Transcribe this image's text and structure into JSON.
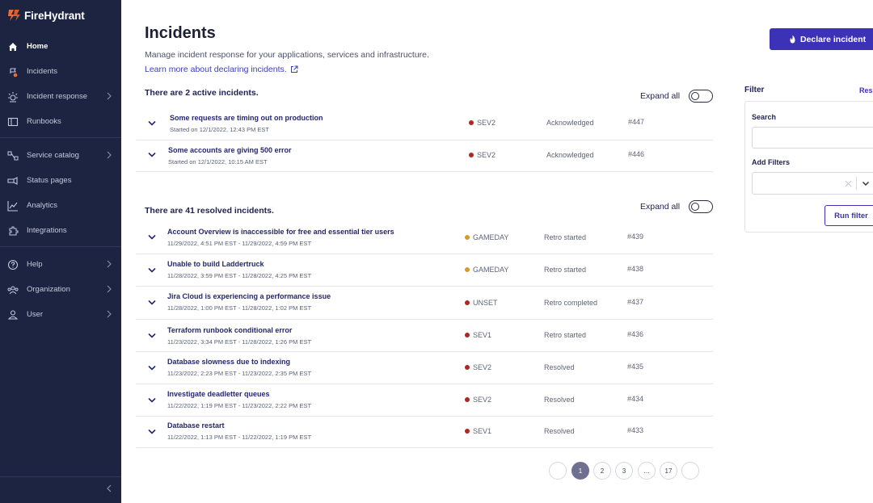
{
  "app": {
    "brand": "FireHydrant"
  },
  "colors": {
    "sidebar": "#1c2442",
    "accent": "#3b32b8",
    "link": "#3b3fb5",
    "sev_red": "#b3261e",
    "sev_gameday": "#d69a2d"
  },
  "sidebar": {
    "items": [
      {
        "label": "Home",
        "icon": "home-icon"
      },
      {
        "label": "Incidents",
        "icon": "incidents-icon"
      },
      {
        "label": "Incident response",
        "icon": "incident-response-icon"
      },
      {
        "label": "Runbooks",
        "icon": "runbooks-icon"
      },
      {
        "label": "Service catalog",
        "icon": "service-catalog-icon"
      },
      {
        "label": "Status pages",
        "icon": "status-pages-icon"
      },
      {
        "label": "Analytics",
        "icon": "analytics-icon"
      },
      {
        "label": "Integrations",
        "icon": "integrations-icon"
      },
      {
        "label": "Help",
        "icon": "help-icon"
      },
      {
        "label": "Organization",
        "icon": "organization-icon"
      },
      {
        "label": "User",
        "icon": "user-icon"
      }
    ]
  },
  "header": {
    "title": "Incidents",
    "subtitle": "Manage incident response for your applications, services and infrastructure.",
    "learn_more": "Learn more about declaring incidents.",
    "declare_button": "Declare incident"
  },
  "active": {
    "heading": "There are 2 active incidents.",
    "expand_all": "Expand all",
    "rows": [
      {
        "title": "Some requests are timing out on production",
        "meta": "Started on 12/1/2022, 12:43 PM EST",
        "sev": "SEV2",
        "sev_color": "#b3261e",
        "status": "Acknowledged",
        "number": "#447"
      },
      {
        "title": "Some accounts are giving 500 error",
        "meta": "Started on 12/1/2022, 10:15 AM EST",
        "sev": "SEV2",
        "sev_color": "#b3261e",
        "status": "Acknowledged",
        "number": "#446"
      }
    ]
  },
  "resolved": {
    "heading": "There are 41 resolved incidents.",
    "expand_all": "Expand all",
    "rows": [
      {
        "title": "Account Overview is inaccessible for free and essential tier users",
        "meta": "11/29/2022, 4:51 PM EST - 11/29/2022, 4:59 PM EST",
        "sev": "GAMEDAY",
        "sev_color": "#d69a2d",
        "status": "Retro started",
        "number": "#439"
      },
      {
        "title": "Unable to build Laddertruck",
        "meta": "11/28/2022, 3:59 PM EST - 11/28/2022, 4:25 PM EST",
        "sev": "GAMEDAY",
        "sev_color": "#d69a2d",
        "status": "Retro started",
        "number": "#438"
      },
      {
        "title": "Jira Cloud is experiencing a performance issue",
        "meta": "11/28/2022, 1:00 PM EST - 11/28/2022, 1:02 PM EST",
        "sev": "UNSET",
        "sev_color": "#b3261e",
        "status": "Retro completed",
        "number": "#437"
      },
      {
        "title": "Terraform runbook conditional error",
        "meta": "11/23/2022, 3:34 PM EST - 11/28/2022, 1:26 PM EST",
        "sev": "SEV1",
        "sev_color": "#b3261e",
        "status": "Retro started",
        "number": "#436"
      },
      {
        "title": "Database slowness due to indexing",
        "meta": "11/23/2022, 2:23 PM EST - 11/23/2022, 2:35 PM EST",
        "sev": "SEV2",
        "sev_color": "#b3261e",
        "status": "Resolved",
        "number": "#435"
      },
      {
        "title": "Investigate deadletter queues",
        "meta": "11/22/2022, 1:19 PM EST - 11/23/2022, 2:22 PM EST",
        "sev": "SEV2",
        "sev_color": "#b3261e",
        "status": "Resolved",
        "number": "#434"
      },
      {
        "title": "Database restart",
        "meta": "11/22/2022, 1:13 PM EST - 11/22/2022, 1:19 PM EST",
        "sev": "SEV1",
        "sev_color": "#b3261e",
        "status": "Resolved",
        "number": "#433"
      }
    ]
  },
  "pagination": {
    "pages": [
      "1",
      "2",
      "3",
      "...",
      "17"
    ],
    "current": "1"
  },
  "filter": {
    "title": "Filter",
    "reset": "Res",
    "search_label": "Search",
    "search_value": "",
    "add_filters_label": "Add Filters",
    "run_button": "Run filter"
  }
}
